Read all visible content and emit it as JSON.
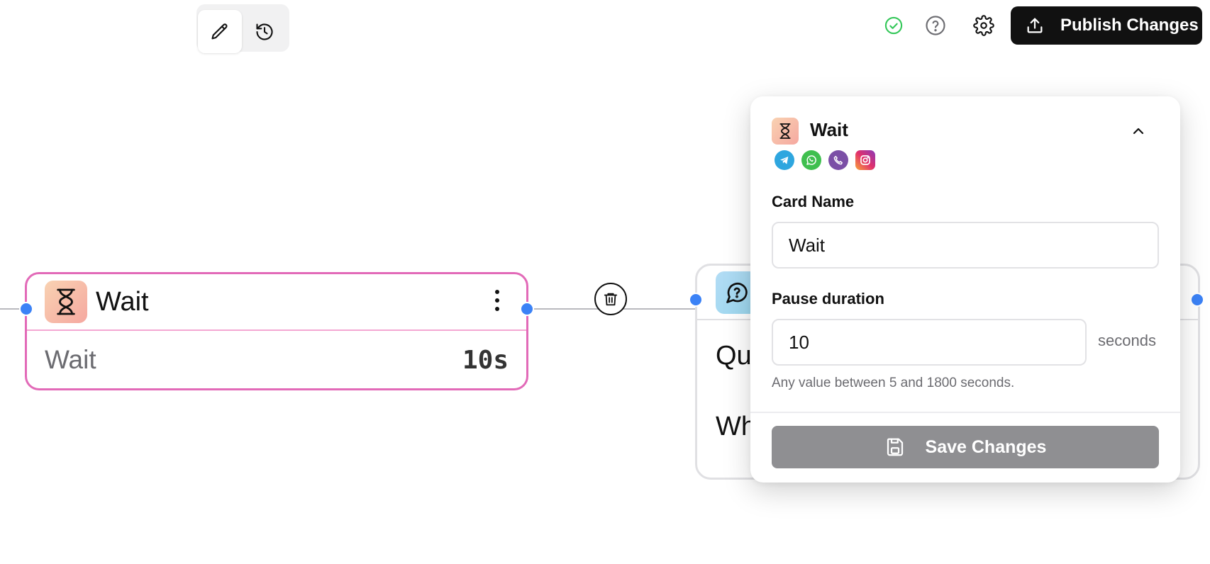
{
  "toolbar": {
    "edit_icon": "pencil-icon",
    "history_icon": "history-icon",
    "status_icon": "check-circle-icon",
    "help_icon": "question-circle-icon",
    "settings_icon": "gear-icon",
    "publish_label": "Publish Changes",
    "publish_icon": "upload-icon"
  },
  "wait_node": {
    "title": "Wait",
    "label": "Wait",
    "value": "10s"
  },
  "quiz_node": {
    "row1": "Qui",
    "row2": "Wh"
  },
  "panel": {
    "title": "Wait",
    "channels": [
      "telegram",
      "whatsapp",
      "viber",
      "instagram"
    ],
    "card_name_label": "Card Name",
    "card_name_value": "Wait",
    "pause_label": "Pause duration",
    "pause_value": "10",
    "pause_unit": "seconds",
    "help_text": "Any value between 5 and 1800 seconds.",
    "save_label": "Save Changes"
  },
  "colors": {
    "accent_pink": "#e26ab8",
    "node_dot": "#3b82f6",
    "publish_bg": "#111111",
    "save_bg": "#8f8f92",
    "status_green": "#34c759"
  }
}
